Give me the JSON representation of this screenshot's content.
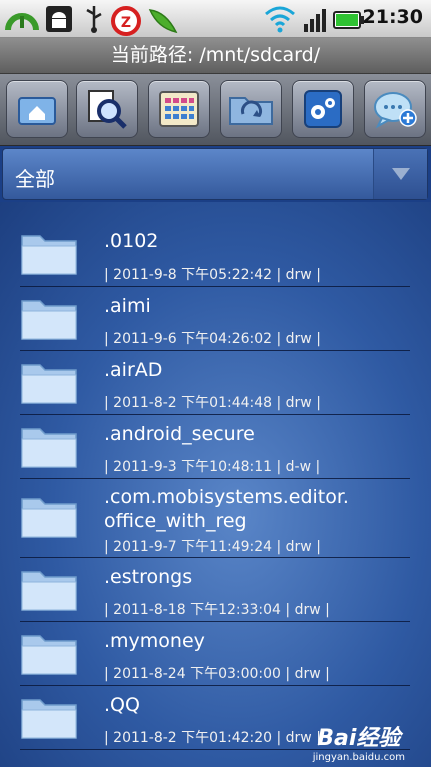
{
  "status": {
    "time": "21:30",
    "icons": [
      "status-ring-icon",
      "android-icon",
      "usb-icon",
      "alarm-clock-icon",
      "peapod-icon",
      "wifi-icon",
      "signal-icon",
      "battery-icon"
    ]
  },
  "path": {
    "text": "当前路径: /mnt/sdcard/"
  },
  "toolbar": {
    "buttons": [
      "home-icon",
      "search-icon",
      "grid-icon",
      "folder-refresh-icon",
      "tools-icon",
      "chat-add-icon"
    ]
  },
  "filter": {
    "selected": "全部"
  },
  "files": [
    {
      "name": ".0102",
      "meta": "| 2011-9-8 下午05:22:42 | drw |"
    },
    {
      "name": ".aimi",
      "meta": "| 2011-9-6 下午04:26:02 | drw |"
    },
    {
      "name": ".airAD",
      "meta": "| 2011-8-2 下午01:44:48 | drw |"
    },
    {
      "name": ".android_secure",
      "meta": "| 2011-9-3 下午10:48:11 | d-w |"
    },
    {
      "name_line1": ".com.mobisystems.editor.",
      "name_line2": "office_with_reg",
      "meta": "| 2011-9-7 下午11:49:24 | drw |"
    },
    {
      "name": ".estrongs",
      "meta": "| 2011-8-18 下午12:33:04 | drw |"
    },
    {
      "name": ".mymoney",
      "meta": "| 2011-8-24 下午03:00:00 | drw |"
    },
    {
      "name": ".QQ",
      "meta": "| 2011-8-2 下午01:42:20 | drw |"
    }
  ],
  "watermark": {
    "main": "Bai经验",
    "sub": "jingyan.baidu.com"
  }
}
